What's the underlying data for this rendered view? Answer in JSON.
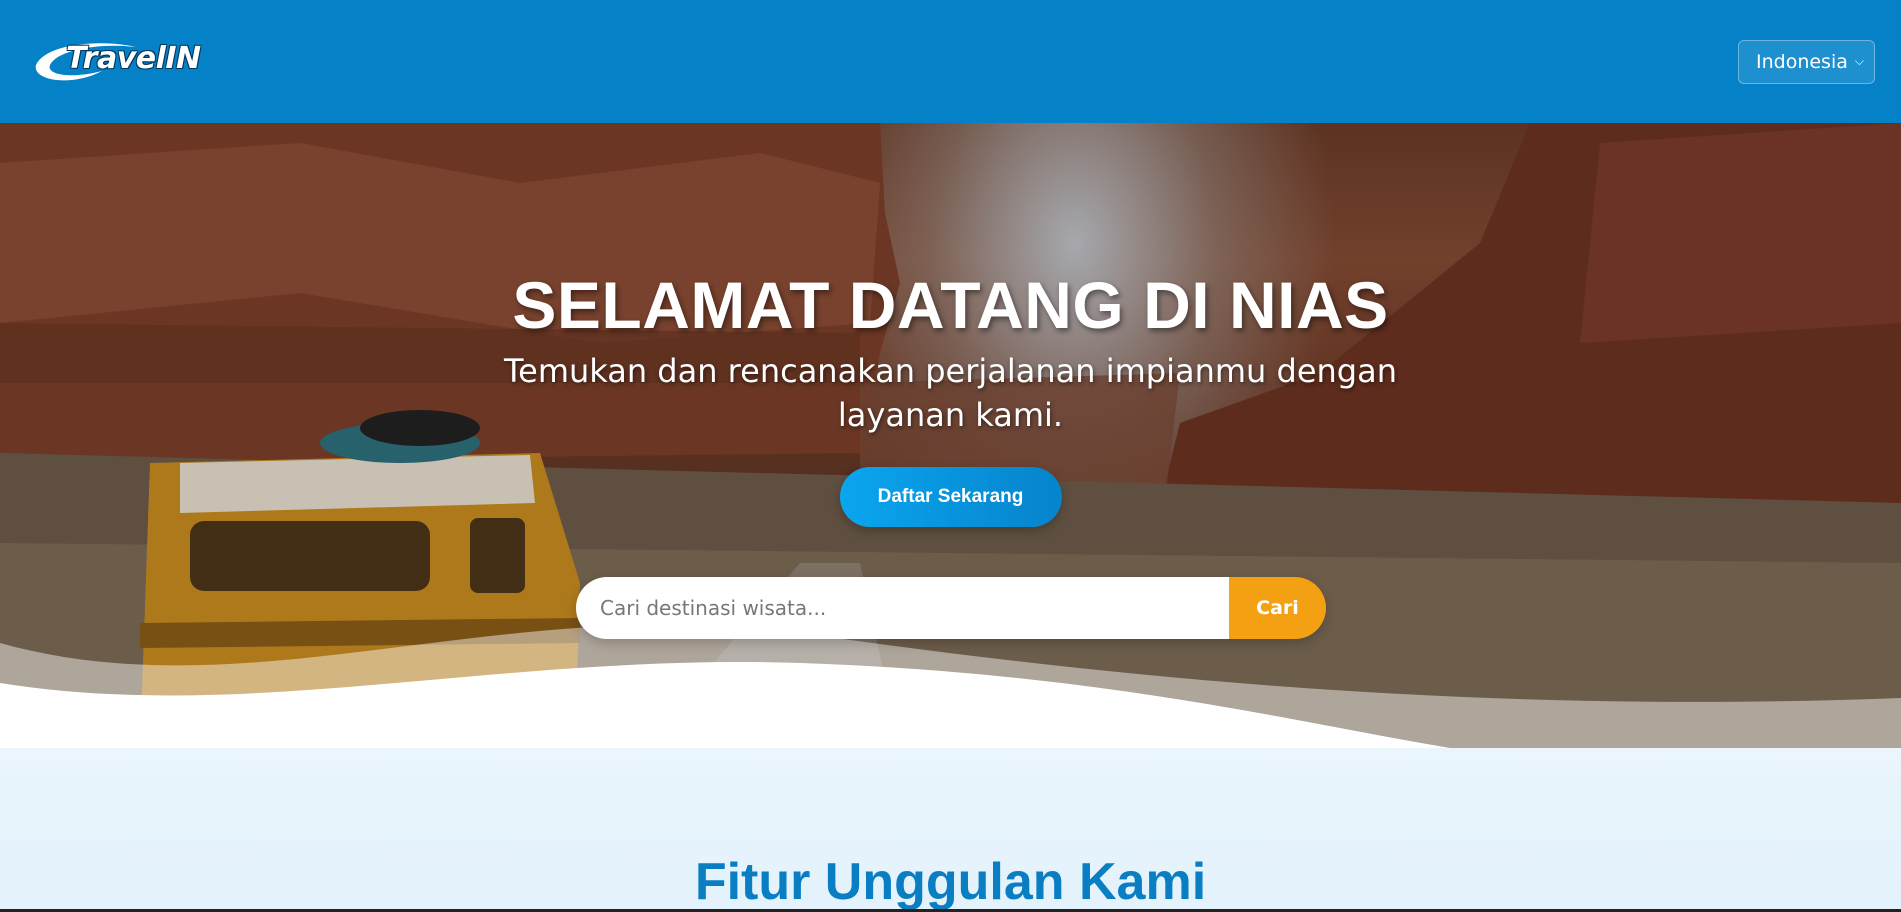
{
  "header": {
    "logo_text": "TravelIN",
    "language_select": {
      "selected": "Indonesia"
    }
  },
  "hero": {
    "title": "SELAMAT DATANG DI NIAS",
    "subtitle": "Temukan dan rencanakan perjalanan impianmu dengan layanan kami.",
    "cta_label": "Daftar Sekarang",
    "search": {
      "placeholder": "Cari destinasi wisata...",
      "value": "",
      "button_label": "Cari"
    }
  },
  "features": {
    "title": "Fitur Unggulan Kami"
  },
  "colors": {
    "navbar": "#0581c7",
    "cta": "#0aa6ef",
    "search_button": "#f4a013",
    "features_bg": "#eaf5fc",
    "features_title": "#0a7ec2"
  },
  "icons": {
    "language_dropdown": "chevron-down-icon"
  }
}
